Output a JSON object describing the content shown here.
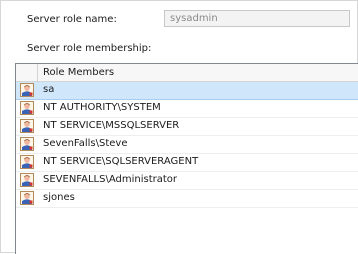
{
  "form": {
    "role_name_label": "Server role name:",
    "role_name_value": "sysadmin",
    "membership_label": "Server role membership:"
  },
  "members_grid": {
    "column_header": "Role Members",
    "rows": [
      {
        "name": "sa",
        "icon": "user-icon",
        "selected": true
      },
      {
        "name": "NT AUTHORITY\\SYSTEM",
        "icon": "user-icon"
      },
      {
        "name": "NT SERVICE\\MSSQLSERVER",
        "icon": "user-icon"
      },
      {
        "name": "SevenFalls\\Steve",
        "icon": "user-icon"
      },
      {
        "name": "NT SERVICE\\SQLSERVERAGENT",
        "icon": "user-icon"
      },
      {
        "name": "SEVENFALLS\\Administrator",
        "icon": "user-icon"
      },
      {
        "name": "sjones",
        "icon": "user-icon"
      }
    ]
  },
  "colors": {
    "selection": "#cfe6fb",
    "icon_face": "#f0b7a0",
    "icon_body": "#3b63b5",
    "icon_accent": "#d9342b"
  }
}
